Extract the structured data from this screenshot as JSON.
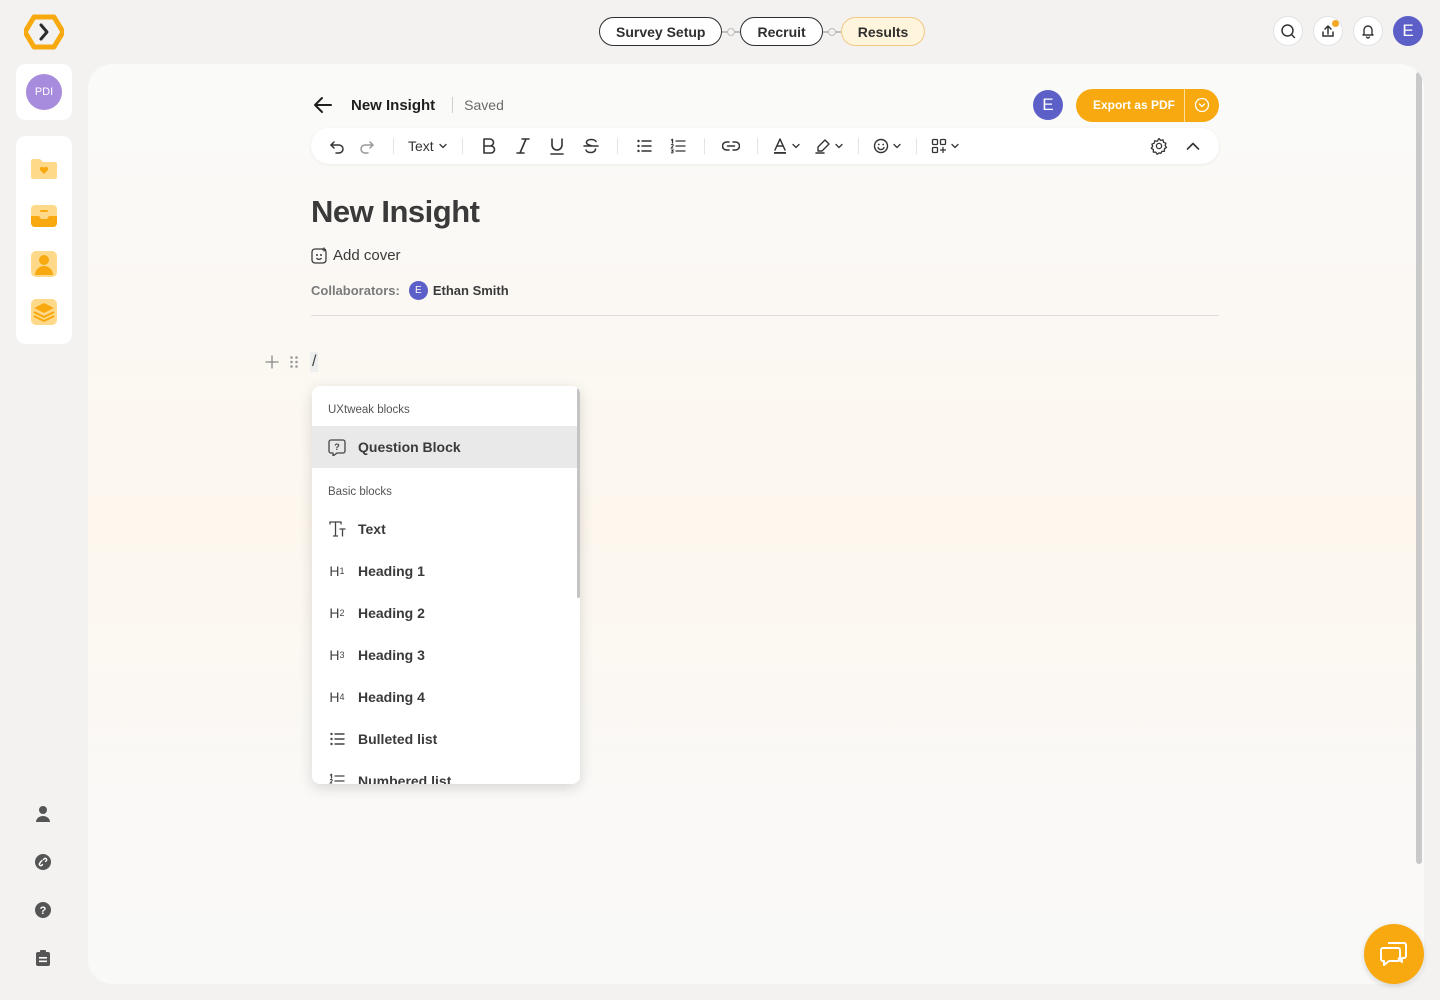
{
  "stepper": {
    "steps": [
      {
        "label": "Survey Setup"
      },
      {
        "label": "Recruit"
      },
      {
        "label": "Results"
      }
    ],
    "active_step": "Results"
  },
  "user": {
    "initial": "E"
  },
  "workspace": {
    "initials": "PDI"
  },
  "document": {
    "name": "New Insight",
    "status": "Saved",
    "title": "New Insight",
    "add_cover_label": "Add cover",
    "collaborators_label": "Collaborators:",
    "collaborator_initial": "E",
    "collaborator_name": "Ethan Smith",
    "slash_input": "/"
  },
  "export": {
    "label": "Export as PDF"
  },
  "toolbar": {
    "text_style_label": "Text"
  },
  "slash_menu": {
    "sections": [
      {
        "title": "UXtweak blocks",
        "items": [
          {
            "label": "Question Block",
            "icon": "question-block-icon",
            "selected": true
          }
        ]
      },
      {
        "title": "Basic blocks",
        "items": [
          {
            "label": "Text",
            "icon": "text-icon"
          },
          {
            "label": "Heading 1",
            "icon": "h1"
          },
          {
            "label": "Heading 2",
            "icon": "h2"
          },
          {
            "label": "Heading 3",
            "icon": "h3"
          },
          {
            "label": "Heading 4",
            "icon": "h4"
          },
          {
            "label": "Bulleted list",
            "icon": "bulleted-list-icon"
          },
          {
            "label": "Numbered list",
            "icon": "numbered-list-icon"
          }
        ]
      }
    ]
  },
  "colors": {
    "accent": "#f7a90f",
    "avatar": "#5b5fc7",
    "workspace_avatar": "#a78bdc",
    "active_step_bg": "#fff4dc"
  }
}
